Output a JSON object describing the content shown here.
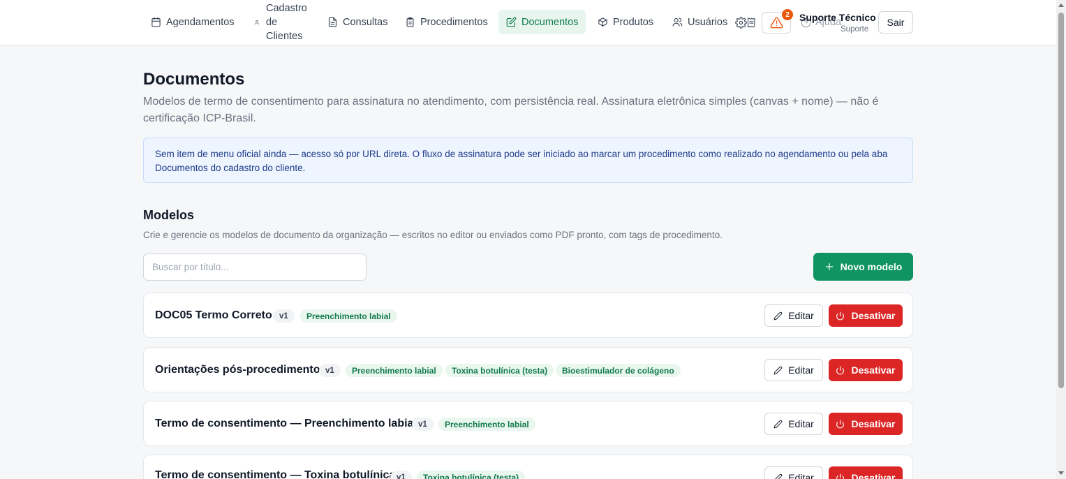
{
  "nav": {
    "items": [
      {
        "label": "Agendamentos",
        "icon": "calendar-icon"
      },
      {
        "label": "Cadastro de Clientes",
        "icon": "user-icon"
      },
      {
        "label": "Consultas",
        "icon": "file-text-icon"
      },
      {
        "label": "Procedimentos",
        "icon": "clipboard-icon"
      },
      {
        "label": "Documentos",
        "icon": "edit-document-icon",
        "active": true
      },
      {
        "label": "Produtos",
        "icon": "box-icon"
      },
      {
        "label": "Usuários",
        "icon": "users-icon"
      }
    ],
    "alert_count": "2",
    "help_label": "Ajuda",
    "user_name": "Suporte Técnico",
    "user_role": "Suporte",
    "logout_label": "Sair"
  },
  "page": {
    "title": "Documentos",
    "description": "Modelos de termo de consentimento para assinatura no atendimento, com persistência real. Assinatura eletrônica simples (canvas + nome) — não é certificação ICP-Brasil.",
    "info": "Sem item de menu oficial ainda — acesso só por URL direta. O fluxo de assinatura pode ser iniciado ao marcar um procedimento como realizado no agendamento ou pela aba Documentos do cadastro do cliente."
  },
  "models": {
    "title": "Modelos",
    "description": "Crie e gerencie os modelos de documento da organização — escritos no editor ou enviados como PDF pronto, com tags de procedimento.",
    "search_placeholder": "Buscar por título...",
    "new_label": "Novo modelo",
    "edit_label": "Editar",
    "deactivate_label": "Desativar",
    "items": [
      {
        "title": "DOC05 Termo Correto",
        "version": "v1",
        "tags": [
          "Preenchimento labial"
        ]
      },
      {
        "title": "Orientações pós-procedimento",
        "version": "v1",
        "tags": [
          "Preenchimento labial",
          "Toxina botulínica (testa)",
          "Bioestimulador de colágeno"
        ]
      },
      {
        "title": "Termo de consentimento — Preenchimento labial",
        "version": "v1",
        "tags": [
          "Preenchimento labial"
        ]
      },
      {
        "title": "Termo de consentimento — Toxina botulínica",
        "version": "v1",
        "tags": [
          "Toxina botulínica (testa)"
        ]
      }
    ]
  },
  "colors": {
    "accent": "#0f9462",
    "danger": "#dc2626",
    "alert": "#ea580c",
    "info_bg": "#eef5fe"
  }
}
